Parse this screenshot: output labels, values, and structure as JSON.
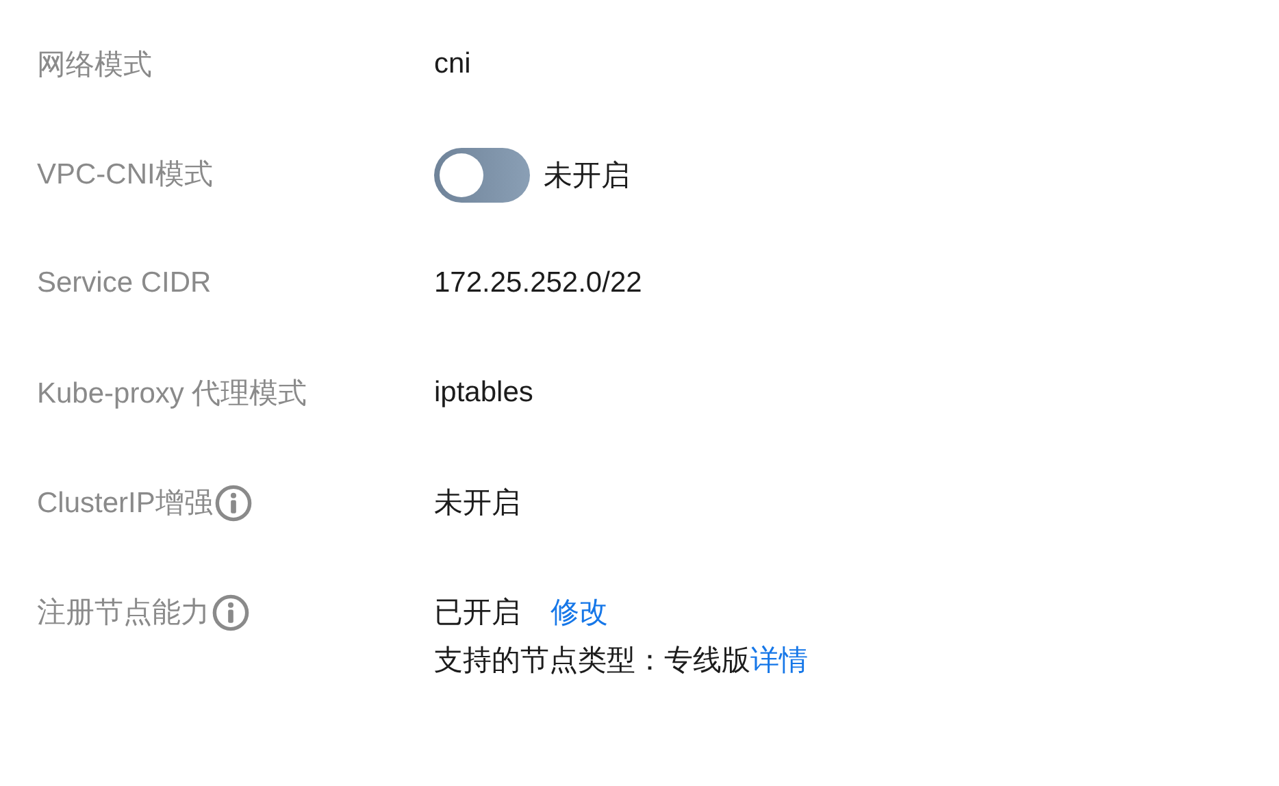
{
  "rows": [
    {
      "label": "网络模式",
      "info": false,
      "lines": [
        {
          "kind": "parts",
          "parts": [
            {
              "kind": "text",
              "text": "cni"
            }
          ]
        }
      ]
    },
    {
      "label": "VPC-CNI模式",
      "info": false,
      "lines": [
        {
          "kind": "parts",
          "parts": [
            {
              "kind": "toggle",
              "on": false
            },
            {
              "kind": "text",
              "text": "未开启"
            }
          ]
        }
      ]
    },
    {
      "label": "Service CIDR",
      "info": false,
      "lines": [
        {
          "kind": "parts",
          "parts": [
            {
              "kind": "text",
              "text": "172.25.252.0/22"
            }
          ]
        }
      ]
    },
    {
      "label": "Kube-proxy 代理模式",
      "info": false,
      "lines": [
        {
          "kind": "parts",
          "parts": [
            {
              "kind": "text",
              "text": "iptables"
            }
          ]
        }
      ]
    },
    {
      "label": "ClusterIP增强",
      "info": true,
      "lines": [
        {
          "kind": "parts",
          "parts": [
            {
              "kind": "text",
              "text": "未开启"
            }
          ]
        }
      ]
    },
    {
      "label": "注册节点能力",
      "info": true,
      "lines": [
        {
          "kind": "parts",
          "parts": [
            {
              "kind": "text",
              "text": "已开启"
            },
            {
              "kind": "link",
              "text": "修改"
            }
          ]
        },
        {
          "kind": "sentence",
          "text": "支持的节点类型：专线版",
          "link": "详情"
        }
      ]
    }
  ]
}
